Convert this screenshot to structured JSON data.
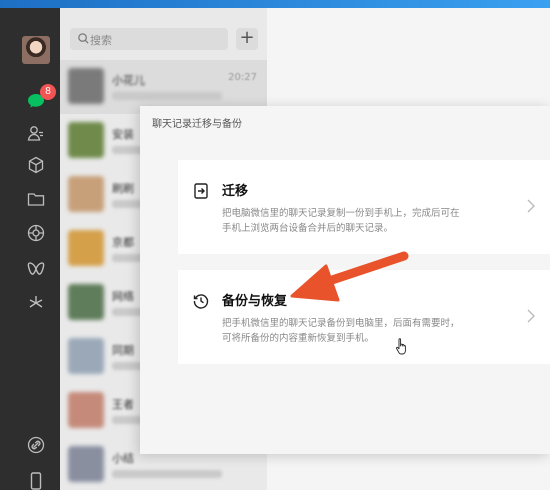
{
  "nav": {
    "chat_badge": "8",
    "icons": [
      "chat-icon",
      "contacts-icon",
      "cube-icon",
      "folder-icon",
      "moments-icon",
      "butterfly-icon",
      "sparkle-icon",
      "link-icon",
      "phone-icon"
    ],
    "accent": "#f25353"
  },
  "search": {
    "placeholder": "搜索",
    "add_label": "+"
  },
  "chats": [
    {
      "name": "小花儿",
      "time": "20:27"
    },
    {
      "name": "安装",
      "time": ""
    },
    {
      "name": "刷刷",
      "time": ""
    },
    {
      "name": "京都",
      "time": ""
    },
    {
      "name": "网络",
      "time": ""
    },
    {
      "name": "同期",
      "time": ""
    },
    {
      "name": "王者",
      "time": ""
    },
    {
      "name": "小结",
      "time": ""
    }
  ],
  "dialog": {
    "title": "聊天记录迁移与备份",
    "migrate": {
      "title": "迁移",
      "desc_line1": "把电脑微信里的聊天记录复制一份到手机上，完成后可在",
      "desc_line2": "手机上浏览两台设备合并后的聊天记录。"
    },
    "backup": {
      "title": "备份与恢复",
      "desc_line1": "把手机微信里的聊天记录备份到电脑里，后面有需要时，",
      "desc_line2": "可将所备份的内容重新恢复到手机。"
    }
  },
  "annotation": {
    "arrow_color": "#e8532b"
  }
}
